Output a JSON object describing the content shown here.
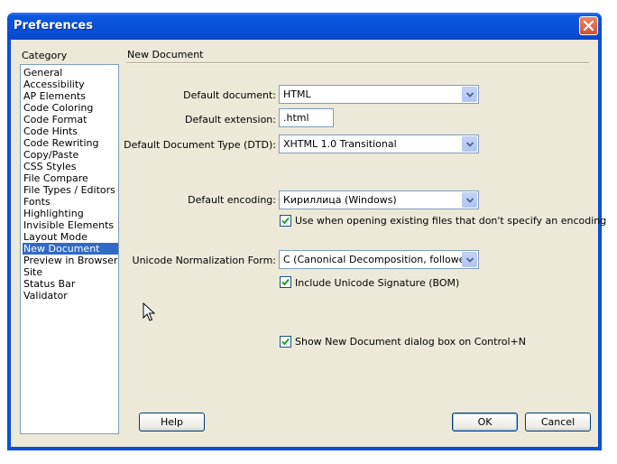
{
  "window": {
    "title": "Preferences"
  },
  "category": {
    "heading": "Category",
    "items": [
      "General",
      "Accessibility",
      "AP Elements",
      "Code Coloring",
      "Code Format",
      "Code Hints",
      "Code Rewriting",
      "Copy/Paste",
      "CSS Styles",
      "File Compare",
      "File Types / Editors",
      "Fonts",
      "Highlighting",
      "Invisible Elements",
      "Layout Mode",
      "New Document",
      "Preview in Browser",
      "Site",
      "Status Bar",
      "Validator"
    ],
    "selected": "New Document"
  },
  "panel": {
    "heading": "New Document",
    "default_document_label": "Default document:",
    "default_document_value": "HTML",
    "default_extension_label": "Default extension:",
    "default_extension_value": ".html",
    "dtd_label": "Default Document Type (DTD):",
    "dtd_value": "XHTML 1.0 Transitional",
    "encoding_label": "Default encoding:",
    "encoding_value": "Кириллица (Windows)",
    "use_encoding_label": "Use when opening existing files that don't specify an encoding",
    "use_encoding_checked": true,
    "normalization_label": "Unicode Normalization Form:",
    "normalization_value": "C (Canonical Decomposition, followed by C",
    "signature_label": "Include Unicode Signature (BOM)",
    "signature_checked": false,
    "show_dialog_label": "Show New Document dialog box on Control+N",
    "show_dialog_checked": true
  },
  "buttons": {
    "help": "Help",
    "ok": "OK",
    "cancel": "Cancel"
  },
  "icons": {
    "close": "close-icon",
    "dropdown": "chevron-down-icon",
    "check": "check-icon",
    "cursor": "mouse-pointer-icon"
  }
}
